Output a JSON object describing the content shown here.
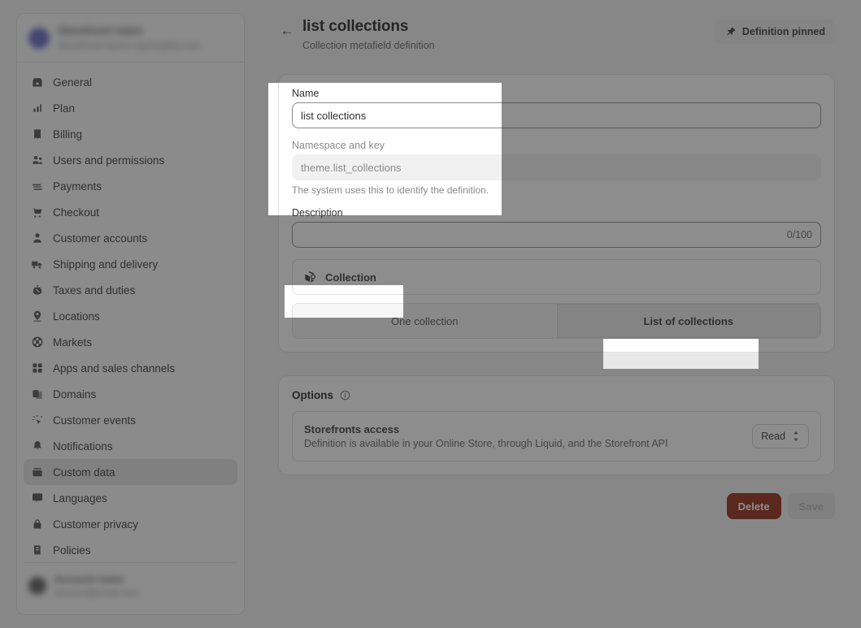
{
  "sidebar": {
    "store": {
      "name": "Storefront name",
      "url": "storefront-name.myshopify.com",
      "avatar_color": "#5c5ec0"
    },
    "items": [
      {
        "label": "General",
        "icon": "store-icon",
        "active": false
      },
      {
        "label": "Plan",
        "icon": "chart-icon",
        "active": false
      },
      {
        "label": "Billing",
        "icon": "receipt-icon",
        "active": false
      },
      {
        "label": "Users and permissions",
        "icon": "users-icon",
        "active": false
      },
      {
        "label": "Payments",
        "icon": "payments-icon",
        "active": false
      },
      {
        "label": "Checkout",
        "icon": "cart-icon",
        "active": false
      },
      {
        "label": "Customer accounts",
        "icon": "person-icon",
        "active": false
      },
      {
        "label": "Shipping and delivery",
        "icon": "truck-icon",
        "active": false
      },
      {
        "label": "Taxes and duties",
        "icon": "taxes-icon",
        "active": false
      },
      {
        "label": "Locations",
        "icon": "location-pin-icon",
        "active": false
      },
      {
        "label": "Markets",
        "icon": "globe-icon",
        "active": false
      },
      {
        "label": "Apps and sales channels",
        "icon": "apps-icon",
        "active": false
      },
      {
        "label": "Domains",
        "icon": "domains-icon",
        "active": false
      },
      {
        "label": "Customer events",
        "icon": "cursor-click-icon",
        "active": false
      },
      {
        "label": "Notifications",
        "icon": "bell-icon",
        "active": false
      },
      {
        "label": "Custom data",
        "icon": "custom-data-icon",
        "active": true
      },
      {
        "label": "Languages",
        "icon": "translate-icon",
        "active": false
      },
      {
        "label": "Customer privacy",
        "icon": "lock-icon",
        "active": false
      },
      {
        "label": "Policies",
        "icon": "policies-icon",
        "active": false
      }
    ],
    "user": {
      "name": "Account name",
      "sub": "account@email.com"
    }
  },
  "header": {
    "back_icon": "back-arrow-icon",
    "title": "list collections",
    "subtitle": "Collection metafield definition",
    "pin_button": {
      "label": "Definition pinned",
      "icon": "pin-icon"
    }
  },
  "form": {
    "name": {
      "label": "Name",
      "value": "list collections"
    },
    "namespace": {
      "label": "Namespace and key",
      "value": "theme.list_collections",
      "help": "The system uses this to identify the definition."
    },
    "description": {
      "label": "Description",
      "value": "",
      "counter": "0/100"
    },
    "type": {
      "label": "Collection",
      "icon": "collection-icon"
    },
    "list_toggle": {
      "options": [
        "One collection",
        "List of collections"
      ],
      "selected": "List of collections"
    }
  },
  "options": {
    "title": "Options",
    "info_icon": "info-icon",
    "rows": [
      {
        "name": "Storefronts access",
        "description": "Definition is available in your Online Store, through Liquid, and the Storefront API",
        "select_value": "Read"
      }
    ]
  },
  "actions": {
    "delete_label": "Delete",
    "save_label": "Save",
    "delete_color": "#8e1f0b"
  }
}
